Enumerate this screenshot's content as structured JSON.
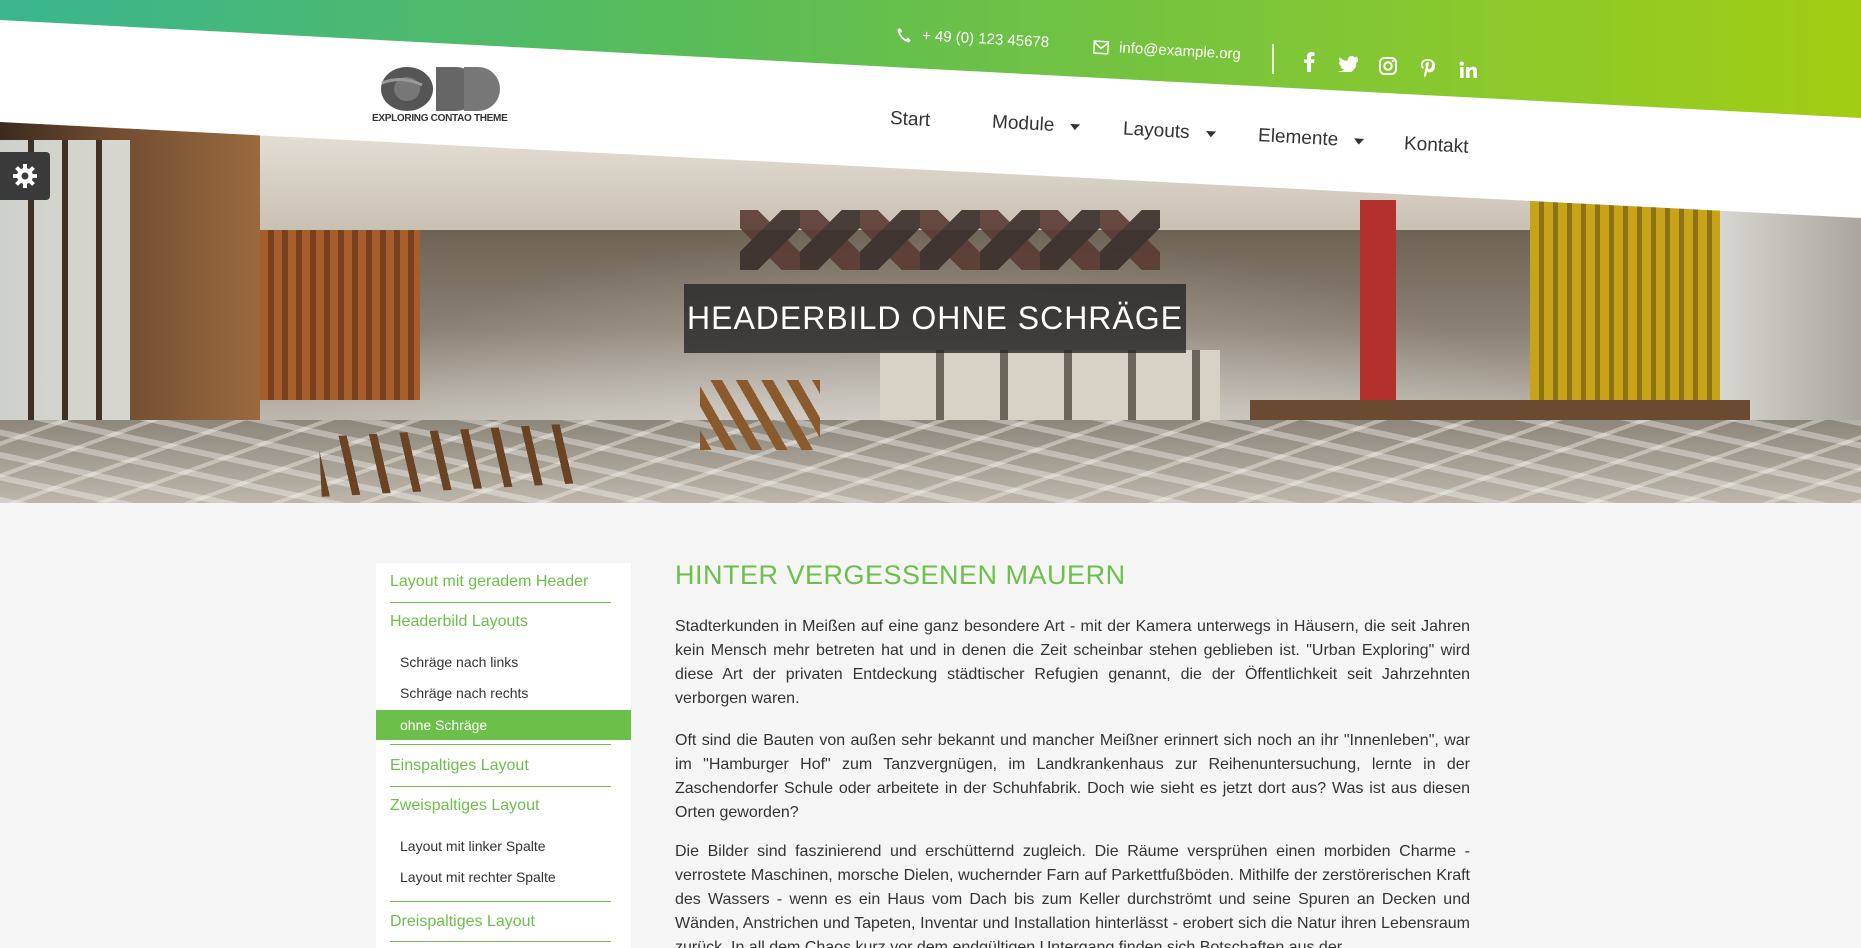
{
  "header": {
    "phone": "+ 49 (0) 123 45678",
    "email": "info@example.org",
    "logo_text": "EXPLORING CONTAO THEME",
    "social": [
      "facebook-icon",
      "twitter-icon",
      "instagram-icon",
      "pinterest-icon",
      "linkedin-icon"
    ],
    "nav": [
      {
        "label": "Start",
        "dropdown": false
      },
      {
        "label": "Module",
        "dropdown": true
      },
      {
        "label": "Layouts",
        "dropdown": true
      },
      {
        "label": "Elemente",
        "dropdown": true
      },
      {
        "label": "Kontakt",
        "dropdown": false
      }
    ]
  },
  "hero": {
    "title": "HEADERBILD OHNE SCHRÄGE"
  },
  "sidebar": {
    "items": [
      {
        "label": "Layout mit geradem Header"
      },
      {
        "label": "Headerbild Layouts"
      },
      {
        "label": "Schräge nach links"
      },
      {
        "label": "Schräge nach rechts"
      },
      {
        "label": "ohne Schräge"
      },
      {
        "label": "Einspaltiges Layout"
      },
      {
        "label": "Zweispaltiges Layout"
      },
      {
        "label": "Layout mit linker Spalte"
      },
      {
        "label": "Layout mit rechter Spalte"
      },
      {
        "label": "Dreispaltiges Layout"
      }
    ]
  },
  "main": {
    "title": "HINTER VERGESSENEN MAUERN",
    "paragraphs": [
      "Stadterkunden in Meißen auf eine ganz besondere Art - mit der Kamera unterwegs in Häusern, die seit Jahren kein Mensch mehr betreten hat und in denen die Zeit scheinbar stehen geblieben ist. \"Urban Exploring\" wird diese Art der privaten Entdeckung städtischer Refugien genannt, die der Öffentlichkeit seit Jahrzehnten verborgen waren.",
      "Oft sind die Bauten von außen sehr bekannt und mancher Meißner erinnert sich noch an ihr \"Innenleben\", war im \"Hamburger Hof\" zum Tanzvergnügen, im Landkrankenhaus zur Reihenuntersuchung, lernte in der Zaschendorfer Schule oder arbeitete in der Schuhfabrik. Doch wie sieht es jetzt dort aus? Was ist aus diesen Orten geworden?",
      "Die Bilder sind faszinierend und erschütternd zugleich. Die Räume versprühen einen morbiden Charme - verrostete Maschinen, morsche Dielen, wuchernder Farn auf Parkettfußböden. Mithilfe der zerstörerischen Kraft des Wassers - wenn es ein Haus vom Dach bis zum Keller durchströmt und seine Spuren an Decken und Wänden, Anstrichen und Tapeten, Inventar und Installation hinterlässt - erobert sich die Natur ihren Lebensraum zurück. In all dem Chaos kurz vor dem endgültigen Untergang finden sich Botschaften aus der"
    ]
  },
  "colors": {
    "accent": "#6cc04a",
    "gradient_start": "#3ab58f",
    "gradient_end": "#a2cd12",
    "text": "#333333"
  }
}
